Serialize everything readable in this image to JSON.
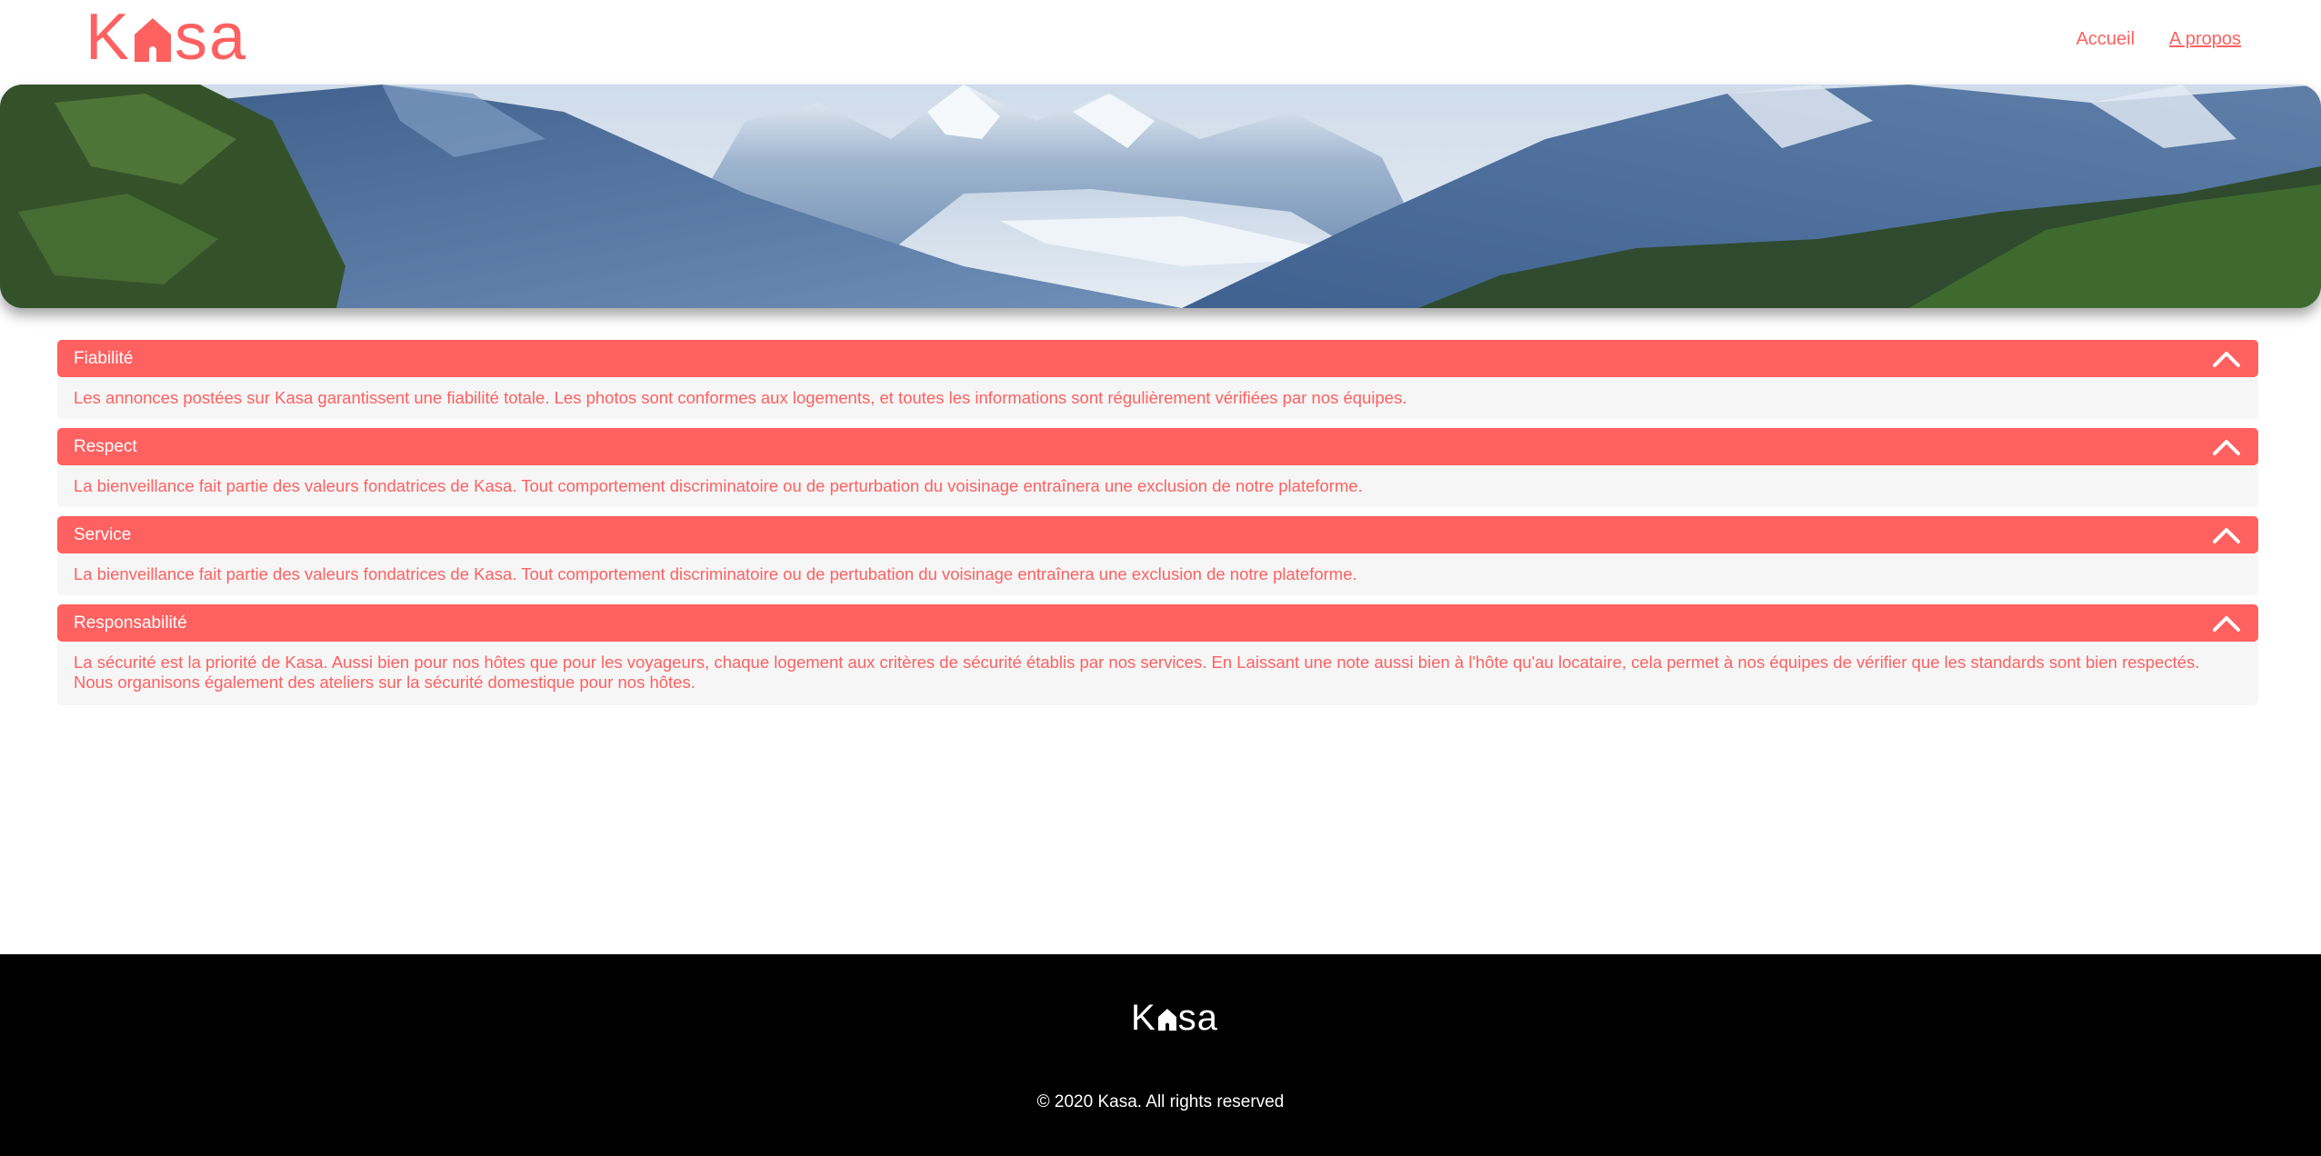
{
  "header": {
    "logo_k": "K",
    "logo_rest": "sa",
    "nav": [
      {
        "label": "Accueil"
      },
      {
        "label": "A propos"
      }
    ]
  },
  "colors": {
    "accent": "#FF6060",
    "panel_bg": "#F6F6F6",
    "footer_bg": "#000000"
  },
  "collapses": [
    {
      "title": "Fiabilité",
      "icon": "chevron-up-icon",
      "text": "Les annonces postées sur Kasa garantissent une fiabilité totale. Les photos sont conformes aux logements, et toutes les informations sont régulièrement vérifiées par nos équipes."
    },
    {
      "title": "Respect",
      "icon": "chevron-up-icon",
      "text": "La bienveillance fait partie des valeurs fondatrices de Kasa. Tout comportement discriminatoire ou de perturbation du voisinage entraînera une exclusion de notre plateforme."
    },
    {
      "title": "Service",
      "icon": "chevron-up-icon",
      "text": "La bienveillance fait partie des valeurs fondatrices de Kasa. Tout comportement discriminatoire ou de pertubation du voisinage entraînera une exclusion de notre plateforme."
    },
    {
      "title": "Responsabilité",
      "icon": "chevron-up-icon",
      "text": "La sécurité est la priorité de Kasa. Aussi bien pour nos hôtes que pour les voyageurs, chaque logement aux critères de sécurité établis par nos services. En Laissant une note aussi bien à l'hôte qu'au locataire, cela permet à nos équipes de vérifier que les standards sont bien respectés. Nous organisons également des ateliers sur la sécurité domestique pour nos hôtes."
    }
  ],
  "footer": {
    "logo_k": "K",
    "logo_rest": "sa",
    "copyright": "© 2020 Kasa. All rights reserved"
  }
}
